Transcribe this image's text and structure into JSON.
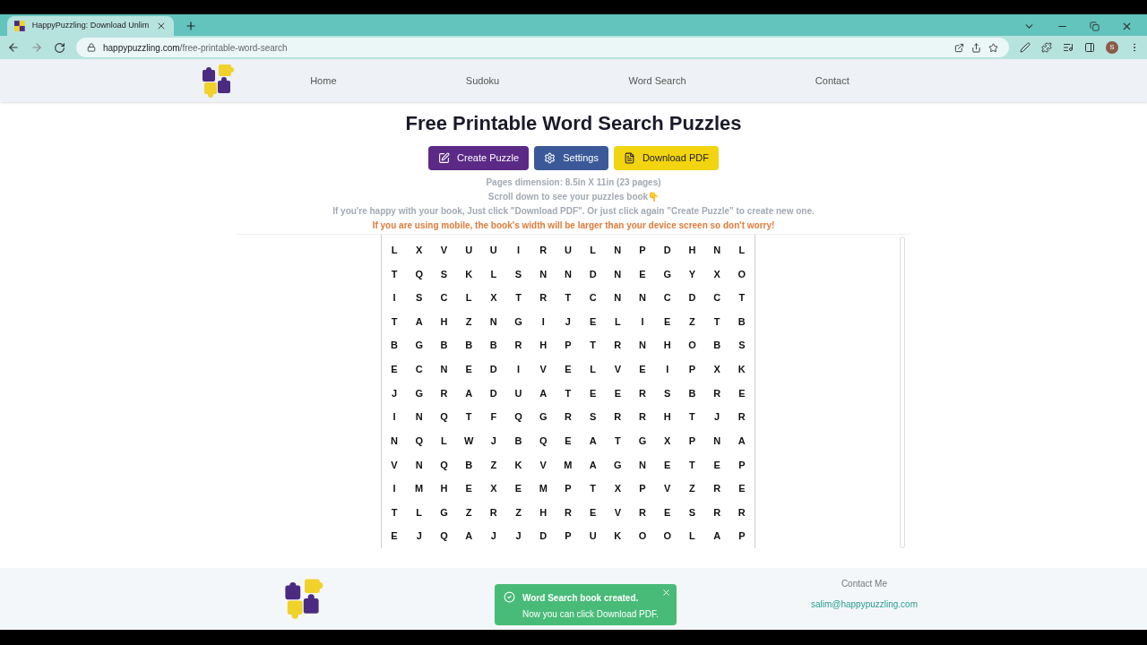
{
  "browser": {
    "tab_title": "HappyPuzzling: Download Unlim",
    "url_host": "happypuzzling.com",
    "url_path": "/free-printable-word-search",
    "profile_initial": "S"
  },
  "nav": {
    "items": [
      {
        "label": "Home"
      },
      {
        "label": "Sudoku"
      },
      {
        "label": "Word Search"
      },
      {
        "label": "Contact"
      }
    ]
  },
  "page": {
    "title": "Free Printable Word Search Puzzles",
    "buttons": [
      {
        "kind": "create",
        "label": "Create Puzzle"
      },
      {
        "kind": "settings",
        "label": "Settings"
      },
      {
        "kind": "download",
        "label": "Download PDF"
      }
    ],
    "info": [
      "Pages dimension: 8.5in X 11in (23 pages)",
      "Scroll down to see your puzzles book👇",
      "If you're happy with your book, Just click \"Download PDF\". Or just click again \"Create Puzzle\" to create new one."
    ],
    "warning": "If you are using mobile, the book's width will be larger than your device screen so don't worry!"
  },
  "grid": [
    [
      "L",
      "X",
      "V",
      "U",
      "U",
      "I",
      "R",
      "U",
      "L",
      "N",
      "P",
      "D",
      "H",
      "N",
      "L"
    ],
    [
      "T",
      "Q",
      "S",
      "K",
      "L",
      "S",
      "N",
      "N",
      "D",
      "N",
      "E",
      "G",
      "Y",
      "X",
      "O"
    ],
    [
      "I",
      "S",
      "C",
      "L",
      "X",
      "T",
      "R",
      "T",
      "C",
      "N",
      "N",
      "C",
      "D",
      "C",
      "T"
    ],
    [
      "T",
      "A",
      "H",
      "Z",
      "N",
      "G",
      "I",
      "J",
      "E",
      "L",
      "I",
      "E",
      "Z",
      "T",
      "B"
    ],
    [
      "B",
      "G",
      "B",
      "B",
      "B",
      "R",
      "H",
      "P",
      "T",
      "R",
      "N",
      "H",
      "O",
      "B",
      "S"
    ],
    [
      "E",
      "C",
      "N",
      "E",
      "D",
      "I",
      "V",
      "E",
      "L",
      "V",
      "E",
      "I",
      "P",
      "X",
      "K"
    ],
    [
      "J",
      "G",
      "R",
      "A",
      "D",
      "U",
      "A",
      "T",
      "E",
      "E",
      "R",
      "S",
      "B",
      "R",
      "E"
    ],
    [
      "I",
      "N",
      "Q",
      "T",
      "F",
      "Q",
      "G",
      "R",
      "S",
      "R",
      "R",
      "H",
      "T",
      "J",
      "R"
    ],
    [
      "N",
      "Q",
      "L",
      "W",
      "J",
      "B",
      "Q",
      "E",
      "A",
      "T",
      "G",
      "X",
      "P",
      "N",
      "A"
    ],
    [
      "V",
      "N",
      "Q",
      "B",
      "Z",
      "K",
      "V",
      "M",
      "A",
      "G",
      "N",
      "E",
      "T",
      "E",
      "P"
    ],
    [
      "I",
      "M",
      "H",
      "E",
      "X",
      "E",
      "M",
      "P",
      "T",
      "X",
      "P",
      "V",
      "Z",
      "R",
      "E"
    ],
    [
      "T",
      "L",
      "G",
      "Z",
      "R",
      "Z",
      "H",
      "R",
      "E",
      "V",
      "R",
      "E",
      "S",
      "R",
      "R"
    ],
    [
      "E",
      "J",
      "Q",
      "A",
      "J",
      "J",
      "D",
      "P",
      "U",
      "K",
      "O",
      "O",
      "L",
      "A",
      "P"
    ]
  ],
  "footer": {
    "contact_heading": "Contact Me",
    "email": "salim@happypuzzling.com"
  },
  "toast": {
    "title": "Word Search book created.",
    "message": "Now you can click Download PDF."
  }
}
